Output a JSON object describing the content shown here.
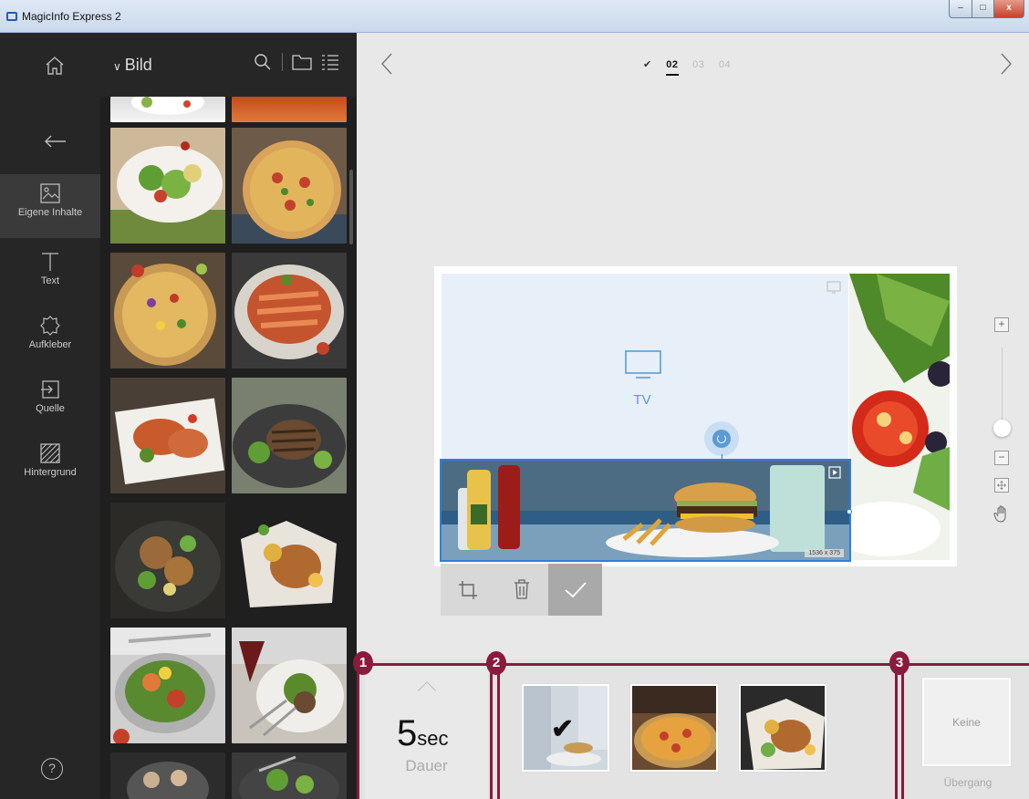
{
  "window": {
    "title": "MagicInfo Express 2",
    "min_label": "–",
    "max_label": "□",
    "close_label": "x"
  },
  "rail": {
    "items": [
      {
        "label": "Eigene Inhalte",
        "icon": "image-icon",
        "active": true
      },
      {
        "label": "Text",
        "icon": "text-icon"
      },
      {
        "label": "Aufkleber",
        "icon": "sticker-icon"
      },
      {
        "label": "Quelle",
        "icon": "source-input-icon"
      },
      {
        "label": "Hintergrund",
        "icon": "background-pattern-icon"
      }
    ],
    "help_label": "?"
  },
  "panel": {
    "title": "Bild",
    "icons": [
      "search-icon",
      "folder-icon",
      "list-view-icon"
    ]
  },
  "pager": {
    "pages": [
      "02",
      "03",
      "04"
    ],
    "current": "02",
    "done_icon": "check-icon"
  },
  "canvas": {
    "tv_label": "TV",
    "image_dims": "1536 x 375"
  },
  "zoom": {
    "plus": "+",
    "minus": "−",
    "level": 0.2
  },
  "bottom": {
    "badges": [
      "1",
      "2",
      "3"
    ],
    "duration": {
      "value": "5",
      "unit": "sec",
      "label": "Dauer"
    },
    "transition": {
      "value": "Keine",
      "label": "Übergang"
    }
  },
  "colors": {
    "accent": "#2d7fde",
    "callout": "#8b1a3d",
    "rail_bg": "#262626"
  }
}
